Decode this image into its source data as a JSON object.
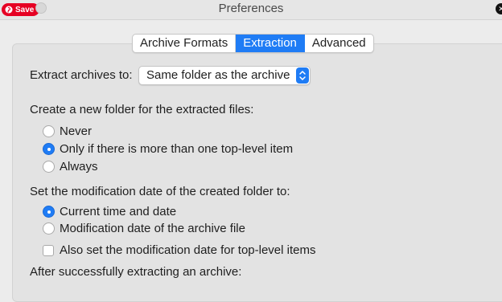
{
  "window": {
    "title": "Preferences",
    "save_button": "Save"
  },
  "tabs": [
    {
      "label": "Archive Formats",
      "active": false
    },
    {
      "label": "Extraction",
      "active": true
    },
    {
      "label": "Advanced",
      "active": false
    }
  ],
  "extract_to": {
    "label": "Extract archives to:",
    "value": "Same folder as the archive"
  },
  "new_folder": {
    "heading": "Create a new folder for the extracted files:",
    "options": [
      {
        "label": "Never",
        "selected": false
      },
      {
        "label": "Only if there is more than one top-level item",
        "selected": true
      },
      {
        "label": "Always",
        "selected": false
      }
    ]
  },
  "mod_date": {
    "heading": "Set the modification date of the created folder to:",
    "options": [
      {
        "label": "Current time and date",
        "selected": true
      },
      {
        "label": "Modification date of the archive file",
        "selected": false
      }
    ],
    "checkbox": {
      "label": "Also set the modification date for top-level items",
      "checked": false
    }
  },
  "after_extract": {
    "heading": "After successfully extracting an archive:"
  },
  "colors": {
    "accent": "#1f7cf5",
    "pinterest": "#e60023",
    "panel": "#e3e3e3",
    "window": "#ececec"
  }
}
